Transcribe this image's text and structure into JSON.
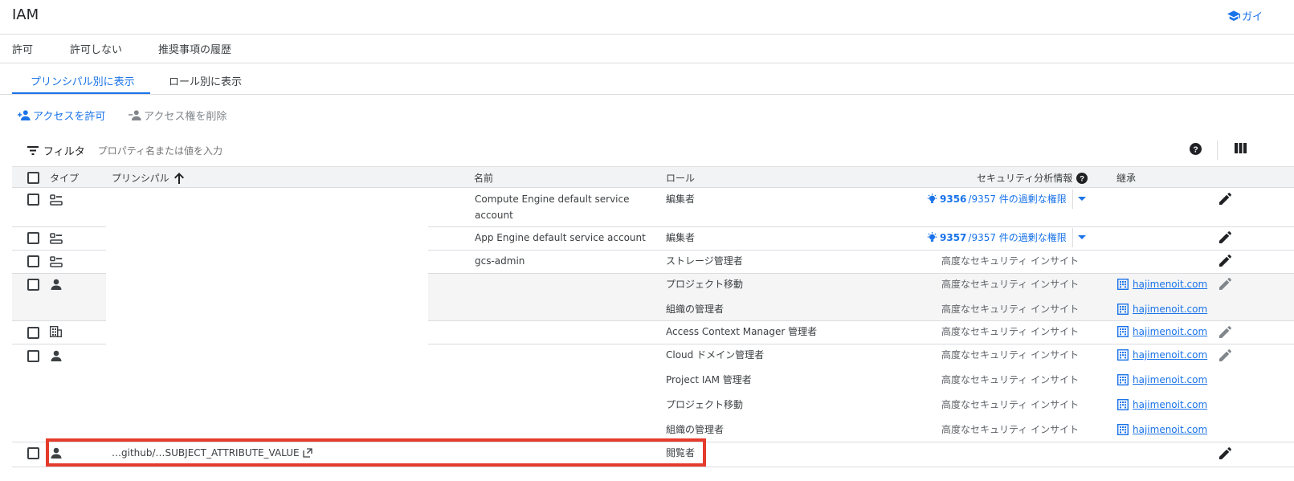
{
  "app": {
    "title": "IAM",
    "guide_label": "ガイ"
  },
  "nav_tabs": [
    "許可",
    "許可しない",
    "推奨事項の履歴"
  ],
  "sub_tabs": [
    "プリンシパル別に表示",
    "ロール別に表示"
  ],
  "actions": {
    "grant": "アクセスを許可",
    "remove": "アクセス権を削除"
  },
  "filter": {
    "label": "フィルタ",
    "placeholder": "プロパティ名または値を入力"
  },
  "columns": {
    "type": "タイプ",
    "principal": "プリンシパル",
    "name": "名前",
    "role": "ロール",
    "security": "セキュリティ分析情報",
    "inheritance": "継承"
  },
  "rows": [
    {
      "type_icon": "service-account-icon",
      "principal": "",
      "name": "Compute Engine default service",
      "name_line2": "account",
      "roles": [
        "編集者"
      ],
      "security_count": "9356",
      "security_total": "/9357 件の過剰な権限",
      "inherit": []
    },
    {
      "type_icon": "service-account-icon",
      "principal": "",
      "name": "App Engine default service account",
      "roles": [
        "編集者"
      ],
      "security_count": "9357",
      "security_total": "/9357 件の過剰な権限",
      "inherit": []
    },
    {
      "type_icon": "service-account-icon",
      "principal": "",
      "name": "gcs-admin",
      "roles": [
        "ストレージ管理者"
      ],
      "security_text": "高度なセキュリティ インサイト",
      "inherit": []
    },
    {
      "type_icon": "person-icon",
      "principal": "",
      "name": "",
      "roles": [
        "プロジェクト移動",
        "組織の管理者"
      ],
      "security_text": "高度なセキュリティ インサイト",
      "inherit": [
        "hajimenoit.com",
        "hajimenoit.com"
      ]
    },
    {
      "type_icon": "domain-icon",
      "principal": "",
      "name": "",
      "roles": [
        "Access Context Manager 管理者"
      ],
      "security_text": "高度なセキュリティ インサイト",
      "inherit": [
        "hajimenoit.com"
      ]
    },
    {
      "type_icon": "person-icon",
      "principal": "",
      "name": "",
      "roles": [
        "Cloud ドメイン管理者",
        "Project IAM 管理者",
        "プロジェクト移動",
        "組織の管理者"
      ],
      "security_text": "高度なセキュリティ インサイト",
      "inherit": [
        "hajimenoit.com",
        "hajimenoit.com",
        "hajimenoit.com",
        "hajimenoit.com"
      ]
    },
    {
      "type_icon": "person-icon",
      "principal": "…github/…SUBJECT_ATTRIBUTE_VALUE",
      "name": "",
      "roles": [
        "閲覧者"
      ],
      "inherit": []
    }
  ],
  "colors": {
    "accent": "#1a73e8",
    "highlight": "#e53b2c",
    "text": "#3c4043",
    "muted": "#5f6368"
  }
}
